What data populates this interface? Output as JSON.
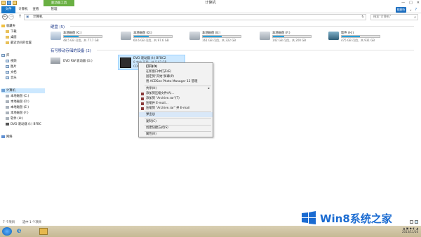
{
  "window": {
    "title": "计算机",
    "tool_tab": "驱动器工具",
    "controls": [
      "—",
      "□",
      "✕"
    ]
  },
  "ribbon": {
    "tabs": [
      "文件",
      "计算机",
      "查看",
      "管理"
    ],
    "help_badge": "随意听"
  },
  "address": {
    "path": "计算机",
    "search_placeholder": "搜索\"计算机\""
  },
  "nav": {
    "items": [
      {
        "label": "收藏夹",
        "icon": "star-icon"
      },
      {
        "label": "下载",
        "icon": "folder-icon"
      },
      {
        "label": "桌面",
        "icon": "folder-icon"
      },
      {
        "label": "最近访问的位置",
        "icon": "folder-icon"
      },
      {
        "label": "库",
        "icon": "library-icon"
      },
      {
        "label": "视频",
        "icon": "library-icon"
      },
      {
        "label": "图片",
        "icon": "library-icon"
      },
      {
        "label": "文档",
        "icon": "library-icon"
      },
      {
        "label": "音乐",
        "icon": "library-icon"
      },
      {
        "label": "计算机",
        "icon": "computer-icon"
      },
      {
        "label": "本地磁盘 (C:)",
        "icon": "drive-icon"
      },
      {
        "label": "本地磁盘 (D:)",
        "icon": "drive-icon"
      },
      {
        "label": "本地磁盘 (E:)",
        "icon": "drive-icon"
      },
      {
        "label": "本地磁盘 (F:)",
        "icon": "drive-icon"
      },
      {
        "label": "软件 (H:)",
        "icon": "drive-icon"
      },
      {
        "label": "DVD 驱动器 (I:) BFBC",
        "icon": "dvd-icon"
      },
      {
        "label": "网络",
        "icon": "network-icon"
      }
    ]
  },
  "content": {
    "hdd_header": "硬盘 (5)",
    "removable_header": "有可移动存储的设备 (2)",
    "drives": [
      {
        "name": "本地磁盘 (C:)",
        "free": "48.5 GB 可用，共 77.7 GB",
        "used_fraction": 0.38,
        "icon": "windows-drive-icon"
      },
      {
        "name": "本地磁盘 (D:)",
        "free": "60.6 GB 可用，共 97.6 GB",
        "used_fraction": 0.38,
        "icon": "hard-drive-icon"
      },
      {
        "name": "本地磁盘 (E:)",
        "free": "161 GB 可用，共 322 GB",
        "used_fraction": 0.5,
        "icon": "hard-drive-icon"
      },
      {
        "name": "本地磁盘 (F:)",
        "free": "142 GB 可用，共 200 GB",
        "used_fraction": 0.29,
        "icon": "hard-drive-icon"
      },
      {
        "name": "软件 (H:)",
        "free": "475 GB 可用，共 931 GB",
        "used_fraction": 0.49,
        "icon": "software-drive-icon"
      }
    ],
    "dvd_rw": {
      "name": "DVD RW 驱动器 (G:)"
    },
    "dvd_selected": {
      "name": "DVD 驱动器 (I:) BFBC2",
      "free": "0 字节 可用，共 5.62 GB",
      "fs": "CDFS"
    }
  },
  "context_menu": {
    "items": [
      {
        "label": "打开(O)",
        "bold": true
      },
      {
        "label": "在新窗口中打开(E)"
      },
      {
        "label": "固定到\"开始\"屏幕(P)"
      },
      {
        "label": "用 ACDSee Photo Manager 12 管理"
      },
      {
        "label": "共享(H)",
        "submenu": true
      },
      {
        "label": "添加到压缩文件(A)...",
        "rar": true
      },
      {
        "label": "添加到 \"Archive.rar\"(T)",
        "rar": true
      },
      {
        "label": "压缩并 E-mail...",
        "rar": true
      },
      {
        "label": "压缩到 \"Archive.rar\" 并 E-mail",
        "rar": true
      },
      {
        "label": "弹出(J)",
        "highlighted": true
      },
      {
        "label": "复制(C)"
      },
      {
        "label": "创建快捷方式(S)"
      },
      {
        "label": "属性(R)"
      }
    ]
  },
  "status": {
    "count": "7 个项目",
    "selection": "选中 1 个项目"
  },
  "taskbar": {
    "ie_glyph": "e",
    "tray_icons": "▲ ▣ ◆ ◐ ◢",
    "clock": "2013/11/16"
  },
  "watermark": {
    "text": "Win8系统之家"
  },
  "colors": {
    "accent": "#1979ca",
    "tool_tab": "#6ab043",
    "drive_bar": "#26a0da",
    "selection": "#cce8ff",
    "menu_highlight": "#d9e8f8",
    "taskbar": "#c9bd9a"
  }
}
